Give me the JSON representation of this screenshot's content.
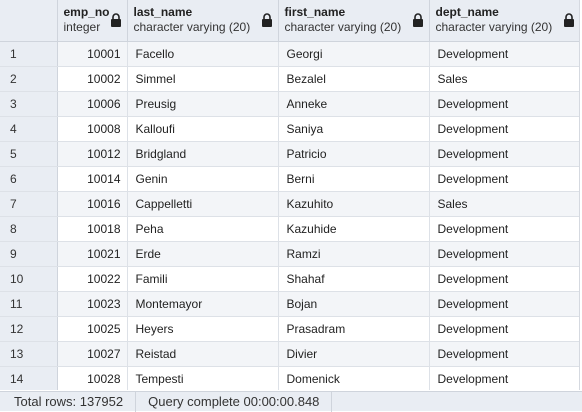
{
  "columns": [
    {
      "key": "emp_no",
      "name": "emp_no",
      "type": "integer"
    },
    {
      "key": "last_name",
      "name": "last_name",
      "type": "character varying (20)"
    },
    {
      "key": "first_name",
      "name": "first_name",
      "type": "character varying (20)"
    },
    {
      "key": "dept_name",
      "name": "dept_name",
      "type": "character varying (20)"
    }
  ],
  "rows": [
    {
      "idx": "1",
      "emp_no": "10001",
      "last_name": "Facello",
      "first_name": "Georgi",
      "dept_name": "Development"
    },
    {
      "idx": "2",
      "emp_no": "10002",
      "last_name": "Simmel",
      "first_name": "Bezalel",
      "dept_name": "Sales"
    },
    {
      "idx": "3",
      "emp_no": "10006",
      "last_name": "Preusig",
      "first_name": "Anneke",
      "dept_name": "Development"
    },
    {
      "idx": "4",
      "emp_no": "10008",
      "last_name": "Kalloufi",
      "first_name": "Saniya",
      "dept_name": "Development"
    },
    {
      "idx": "5",
      "emp_no": "10012",
      "last_name": "Bridgland",
      "first_name": "Patricio",
      "dept_name": "Development"
    },
    {
      "idx": "6",
      "emp_no": "10014",
      "last_name": "Genin",
      "first_name": "Berni",
      "dept_name": "Development"
    },
    {
      "idx": "7",
      "emp_no": "10016",
      "last_name": "Cappelletti",
      "first_name": "Kazuhito",
      "dept_name": "Sales"
    },
    {
      "idx": "8",
      "emp_no": "10018",
      "last_name": "Peha",
      "first_name": "Kazuhide",
      "dept_name": "Development"
    },
    {
      "idx": "9",
      "emp_no": "10021",
      "last_name": "Erde",
      "first_name": "Ramzi",
      "dept_name": "Development"
    },
    {
      "idx": "10",
      "emp_no": "10022",
      "last_name": "Famili",
      "first_name": "Shahaf",
      "dept_name": "Development"
    },
    {
      "idx": "11",
      "emp_no": "10023",
      "last_name": "Montemayor",
      "first_name": "Bojan",
      "dept_name": "Development"
    },
    {
      "idx": "12",
      "emp_no": "10025",
      "last_name": "Heyers",
      "first_name": "Prasadram",
      "dept_name": "Development"
    },
    {
      "idx": "13",
      "emp_no": "10027",
      "last_name": "Reistad",
      "first_name": "Divier",
      "dept_name": "Development"
    },
    {
      "idx": "14",
      "emp_no": "10028",
      "last_name": "Tempesti",
      "first_name": "Domenick",
      "dept_name": "Development"
    }
  ],
  "status": {
    "total_rows": "Total rows: 137952",
    "query_complete": "Query complete 00:00:00.848"
  },
  "icons": {
    "column_lock": "lock-icon"
  }
}
